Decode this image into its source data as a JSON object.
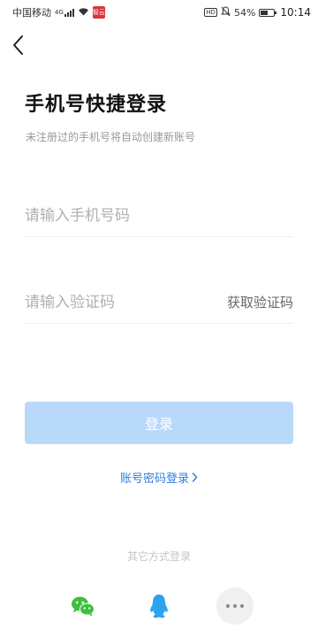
{
  "status_bar": {
    "carrier": "中国移动",
    "network_type": "4G",
    "app_badge": "智云",
    "battery_percent": "54%",
    "battery_level": 0.54,
    "time": "10:14",
    "icons": [
      "signal-icon",
      "wifi-icon",
      "hd-icon",
      "mute-icon",
      "battery-icon"
    ]
  },
  "header": {
    "back_icon": "chevron-left-icon",
    "title": "手机号快捷登录",
    "subtitle": "未注册过的手机号将自动创建新账号"
  },
  "form": {
    "phone": {
      "value": "",
      "placeholder": "请输入手机号码"
    },
    "code": {
      "value": "",
      "placeholder": "请输入验证码"
    },
    "get_code_label": "获取验证码",
    "login_label": "登录",
    "login_button_color": "#b9d9fa"
  },
  "password_login": {
    "label": "账号密码登录",
    "color": "#2f7ce0"
  },
  "other_methods": {
    "label": "其它方式登录",
    "items": [
      {
        "name": "wechat",
        "icon": "wechat-icon",
        "color": "#3fbf3f"
      },
      {
        "name": "qq",
        "icon": "qq-penguin-icon",
        "color": "#2ba3f0"
      },
      {
        "name": "more",
        "icon": "more-dots-icon",
        "color": "#888888"
      }
    ]
  }
}
